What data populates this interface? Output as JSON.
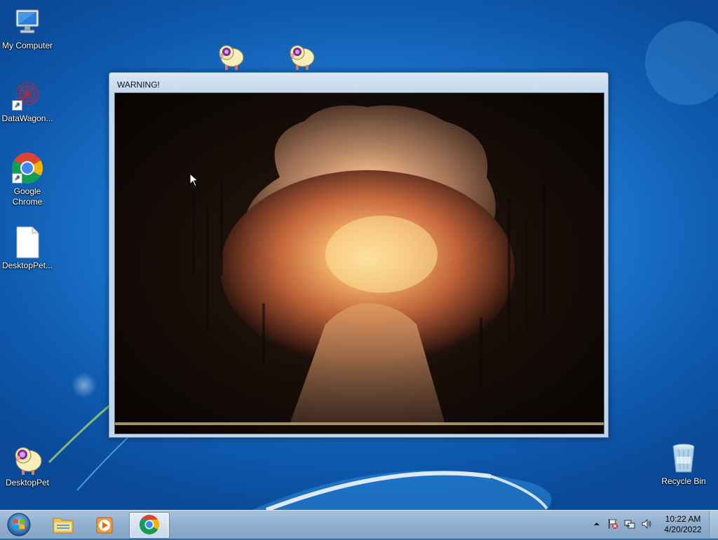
{
  "desktop": {
    "icons": [
      {
        "label": "My Computer",
        "icon": "computer-icon"
      },
      {
        "label": "DataWagon...",
        "icon": "datawagon-icon"
      },
      {
        "label": "Google Chrome",
        "icon": "chrome-icon"
      },
      {
        "label": "DesktopPet...",
        "icon": "document-icon"
      },
      {
        "label": "DesktopPet",
        "icon": "sheep-icon"
      },
      {
        "label": "Recycle Bin",
        "icon": "recycle-bin-icon"
      }
    ]
  },
  "warning_window": {
    "title": "WARNING!",
    "content": "explosion-image"
  },
  "taskbar": {
    "pinned": [
      {
        "name": "start-orb",
        "icon": "windows-logo-icon"
      },
      {
        "name": "file-explorer",
        "icon": "folder-icon"
      },
      {
        "name": "media-player",
        "icon": "media-player-icon"
      },
      {
        "name": "chrome",
        "icon": "chrome-icon",
        "active": true
      }
    ],
    "tray_icons": [
      "show-hidden-icons-icon",
      "action-center-flag-icon",
      "network-icon",
      "volume-icon"
    ],
    "clock": {
      "time": "10:22 AM",
      "date": "4/20/2022"
    }
  },
  "colors": {
    "wallpaper": "#1d78cf",
    "taskbar": "#8faecd",
    "window_frame": "#c5d7ec"
  }
}
